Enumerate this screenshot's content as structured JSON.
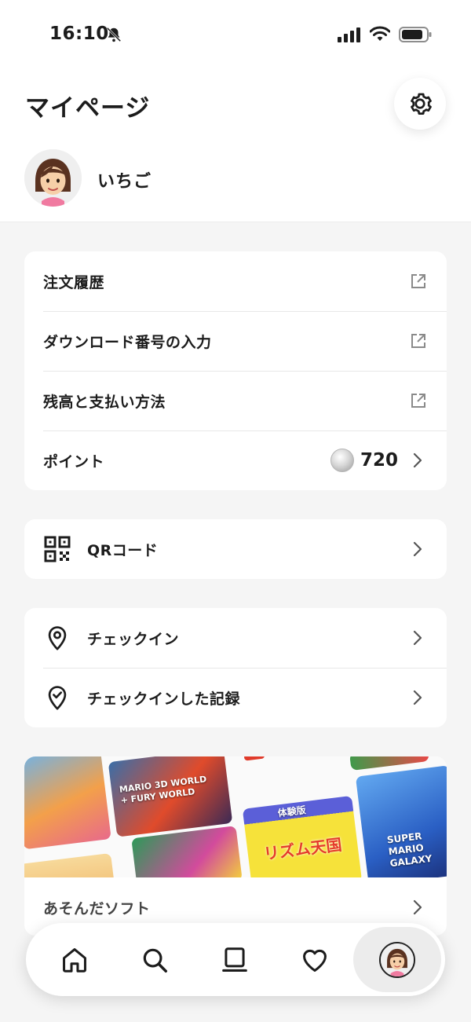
{
  "status_bar": {
    "time": "16:10"
  },
  "header": {
    "title": "マイページ"
  },
  "profile": {
    "name": "いちご"
  },
  "account_menu": [
    {
      "label": "注文履歴",
      "trailing": "external-link-icon"
    },
    {
      "label": "ダウンロード番号の入力",
      "trailing": "external-link-icon"
    },
    {
      "label": "残高と支払い方法",
      "trailing": "external-link-icon"
    },
    {
      "label": "ポイント",
      "value": "720",
      "trailing": "chevron-right-icon"
    }
  ],
  "qr": {
    "label": "QRコード"
  },
  "checkin_menu": [
    {
      "label": "チェックイン",
      "icon": "location-pin-icon"
    },
    {
      "label": "チェックインした記録",
      "icon": "check-badge-icon"
    }
  ],
  "played": {
    "label": "あそんだソフト",
    "tiles": [
      {
        "text": "MARIO 3D WORLD + FURY WORLD"
      },
      {
        "text": "体験版"
      },
      {
        "text": "リズム天国"
      },
      {
        "text": "SUPER MARIO GALAXY"
      }
    ]
  },
  "nav": [
    "home-icon",
    "search-icon",
    "library-icon",
    "heart-icon",
    "profile-avatar"
  ],
  "colors": {
    "background": "#f5f5f5",
    "card": "#ffffff",
    "text": "#1c1c1c",
    "accent": "#2a2a2a"
  }
}
